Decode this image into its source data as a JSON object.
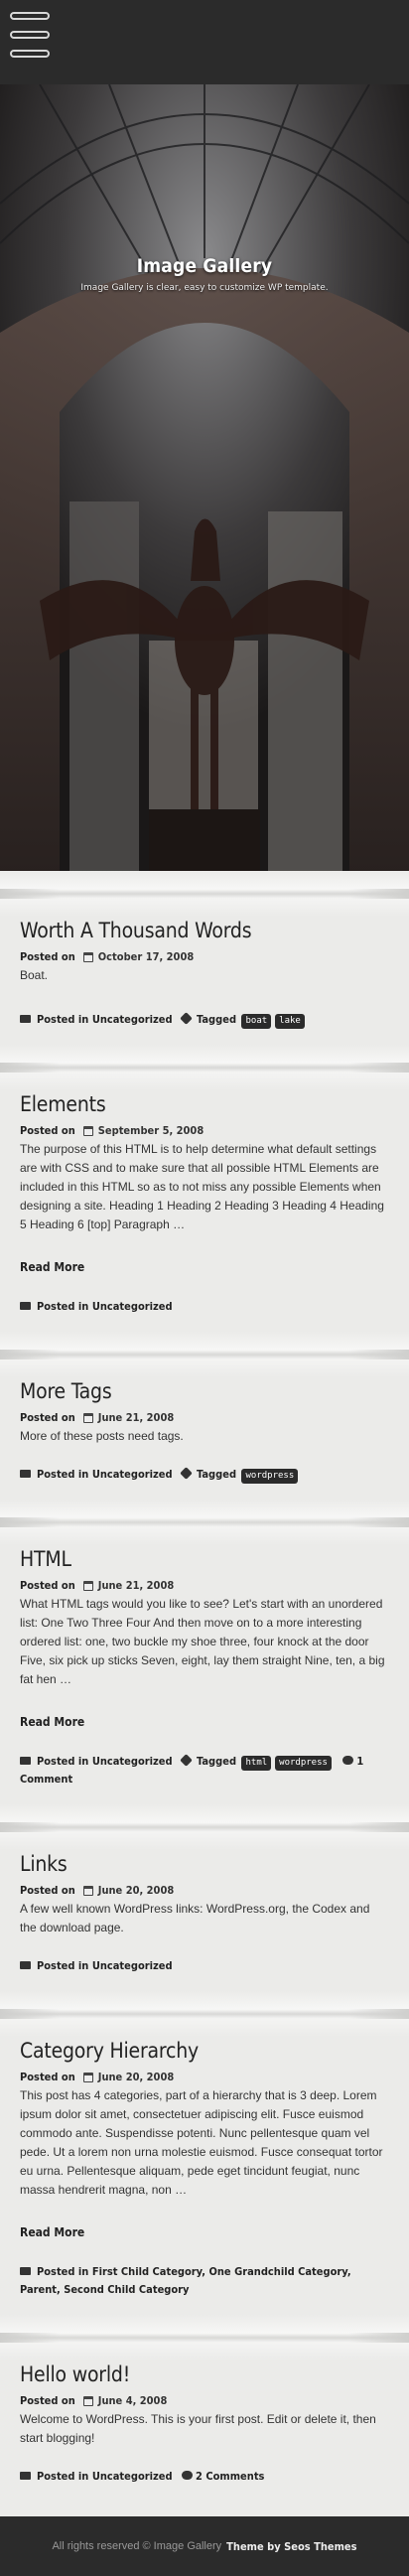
{
  "hero": {
    "title": "Image Gallery",
    "subtitle": "Image Gallery is clear, easy to customize WP template."
  },
  "labels": {
    "posted_on": "Posted on",
    "posted_in": "Posted in",
    "tagged": "Tagged",
    "read_more": "Read More"
  },
  "posts": [
    {
      "title": "Worth A Thousand Words",
      "date": "October 17, 2008",
      "excerpt": "Boat.",
      "categories": "Uncategorized",
      "tags": [
        "boat",
        "lake"
      ],
      "comments": ""
    },
    {
      "title": "Elements",
      "date": "September 5, 2008",
      "excerpt": "The purpose of this HTML is to help determine what default settings are with CSS and to make sure that all possible HTML Elements are included in this HTML so as to not miss any possible Elements when designing a site. Heading 1 Heading 2 Heading 3 Heading 4 Heading 5 Heading 6 [top] Paragraph …",
      "categories": "Uncategorized",
      "tags": [],
      "comments": ""
    },
    {
      "title": "More Tags",
      "date": "June 21, 2008",
      "excerpt": "More of these posts need tags.",
      "categories": "Uncategorized",
      "tags": [
        "wordpress"
      ],
      "comments": ""
    },
    {
      "title": "HTML",
      "date": "June 21, 2008",
      "excerpt": "What HTML tags would you like to see? Let's start with an unordered list: One Two Three Four And then move on to a more interesting ordered list: one, two buckle my shoe three, four knock at the door Five, six pick up sticks Seven, eight, lay them straight Nine, ten, a big fat hen …",
      "categories": "Uncategorized",
      "tags": [
        "html",
        "wordpress"
      ],
      "comments": "1 Comment"
    },
    {
      "title": "Links",
      "date": "June 20, 2008",
      "excerpt": "A few well known WordPress links: WordPress.org, the Codex and the download page.",
      "categories": "Uncategorized",
      "tags": [],
      "comments": ""
    },
    {
      "title": "Category Hierarchy",
      "date": "June 20, 2008",
      "excerpt": "This post has 4 categories, part of a hierarchy that is 3 deep. Lorem ipsum dolor sit amet, consectetuer adipiscing elit. Fusce euismod commodo ante. Suspendisse potenti. Nunc pellentesque quam vel pede. Ut a lorem non urna molestie euismod. Fusce consequat tortor eu urna. Pellentesque aliquam, pede eget tincidunt feugiat, nunc massa hendrerit magna, non …",
      "categories": "First Child Category, One Grandchild Category, Parent, Second Child Category",
      "tags": [],
      "comments": ""
    },
    {
      "title": "Hello world!",
      "date": "June 4, 2008",
      "excerpt": "Welcome to WordPress. This is your first post. Edit or delete it, then start blogging!",
      "categories": "Uncategorized",
      "tags": [],
      "comments": "2 Comments"
    }
  ],
  "footer": {
    "copyright": "All rights reserved © Image Gallery",
    "credit": "Theme by Seos Themes"
  }
}
